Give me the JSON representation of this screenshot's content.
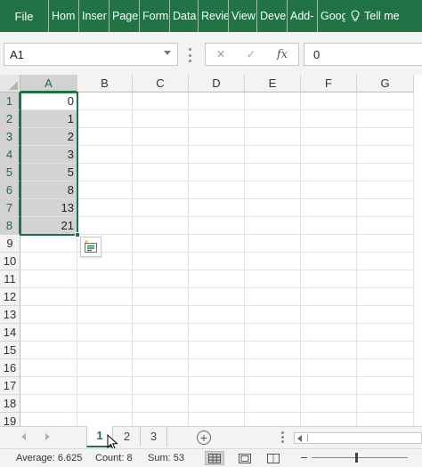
{
  "ribbon": {
    "file_label": "File",
    "tabs": [
      "Hom",
      "Inser",
      "Page",
      "Form",
      "Data",
      "Revie",
      "View",
      "Deve",
      "Add-",
      "Goog"
    ],
    "tell_me": "Tell me"
  },
  "formula_bar": {
    "name_box": "A1",
    "cancel_symbol": "✕",
    "enter_symbol": "✓",
    "fx_label": "fx",
    "value": "0"
  },
  "grid": {
    "columns": [
      "A",
      "B",
      "C",
      "D",
      "E",
      "F",
      "G"
    ],
    "rows": [
      "1",
      "2",
      "3",
      "4",
      "5",
      "6",
      "7",
      "8",
      "9",
      "10",
      "11",
      "12",
      "13",
      "14",
      "15",
      "16",
      "17",
      "18",
      "19"
    ],
    "column_a_values": [
      "0",
      "1",
      "2",
      "3",
      "5",
      "8",
      "13",
      "21"
    ],
    "selection": "A1:A8",
    "active_cell": "A1",
    "accent_color": "#217346",
    "selection_fill": "#d3d3d3"
  },
  "quick_analysis": {
    "icon": "quick-analysis-icon"
  },
  "sheets": {
    "tabs": [
      "1",
      "2",
      "3"
    ],
    "active": "1",
    "add_symbol": "+"
  },
  "status": {
    "average": "Average: 6.625",
    "count": "Count: 8",
    "sum": "Sum: 53"
  }
}
